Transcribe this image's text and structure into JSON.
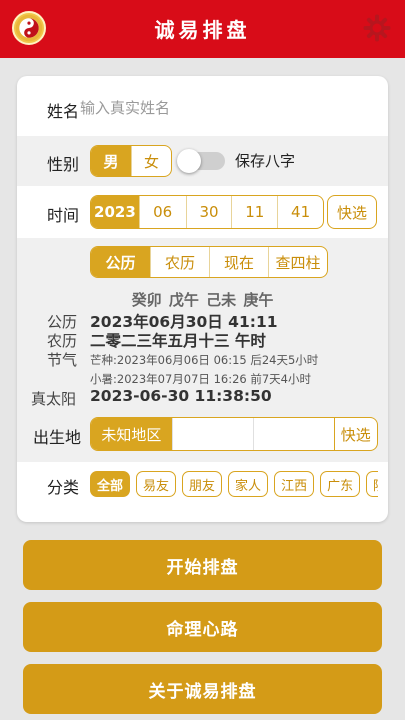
{
  "header": {
    "title": "诚易排盘",
    "logo_icon": "yin-yang-icon",
    "settings_icon": "gear-icon"
  },
  "colors": {
    "header_bg": "#d80c18",
    "accent": "#d9a520",
    "button_bg": "#d49b17"
  },
  "name": {
    "label": "姓名",
    "placeholder": "输入真实姓名",
    "value": ""
  },
  "gender": {
    "label": "性别",
    "options": [
      "男",
      "女"
    ],
    "selected": "男",
    "save_label": "保存八字",
    "save_enabled": false
  },
  "time": {
    "label": "时间",
    "fields": [
      "2023",
      "06",
      "30",
      "11",
      "41"
    ],
    "quick_label": "快选"
  },
  "calendar": {
    "options": [
      "公历",
      "农历",
      "现在",
      "查四柱"
    ],
    "selected": "公历"
  },
  "pillars": "癸卯 戊午 己未 庚午",
  "info": {
    "solar_label": "公历",
    "solar_value": "2023年06月30日 41:11",
    "lunar_label": "农历",
    "lunar_value": "二零二三年五月十三 午时",
    "term_label": "节气",
    "term_line1": "芒种:2023年06月06日 06:15 后24天5小时",
    "term_line2": "小暑:2023年07月07日 16:26 前7天4小时",
    "true_solar_label": "真太阳",
    "true_solar_value": "2023-06-30 11:38:50"
  },
  "birthplace": {
    "label": "出生地",
    "value": "未知地区",
    "quick_label": "快选"
  },
  "category": {
    "label": "分类",
    "chips": [
      "全部",
      "易友",
      "朋友",
      "家人",
      "江西",
      "广东",
      "陕西"
    ],
    "selected": "全部"
  },
  "buttons": {
    "start": "开始排盘",
    "mind": "命理心路",
    "about": "关于诚易排盘"
  }
}
